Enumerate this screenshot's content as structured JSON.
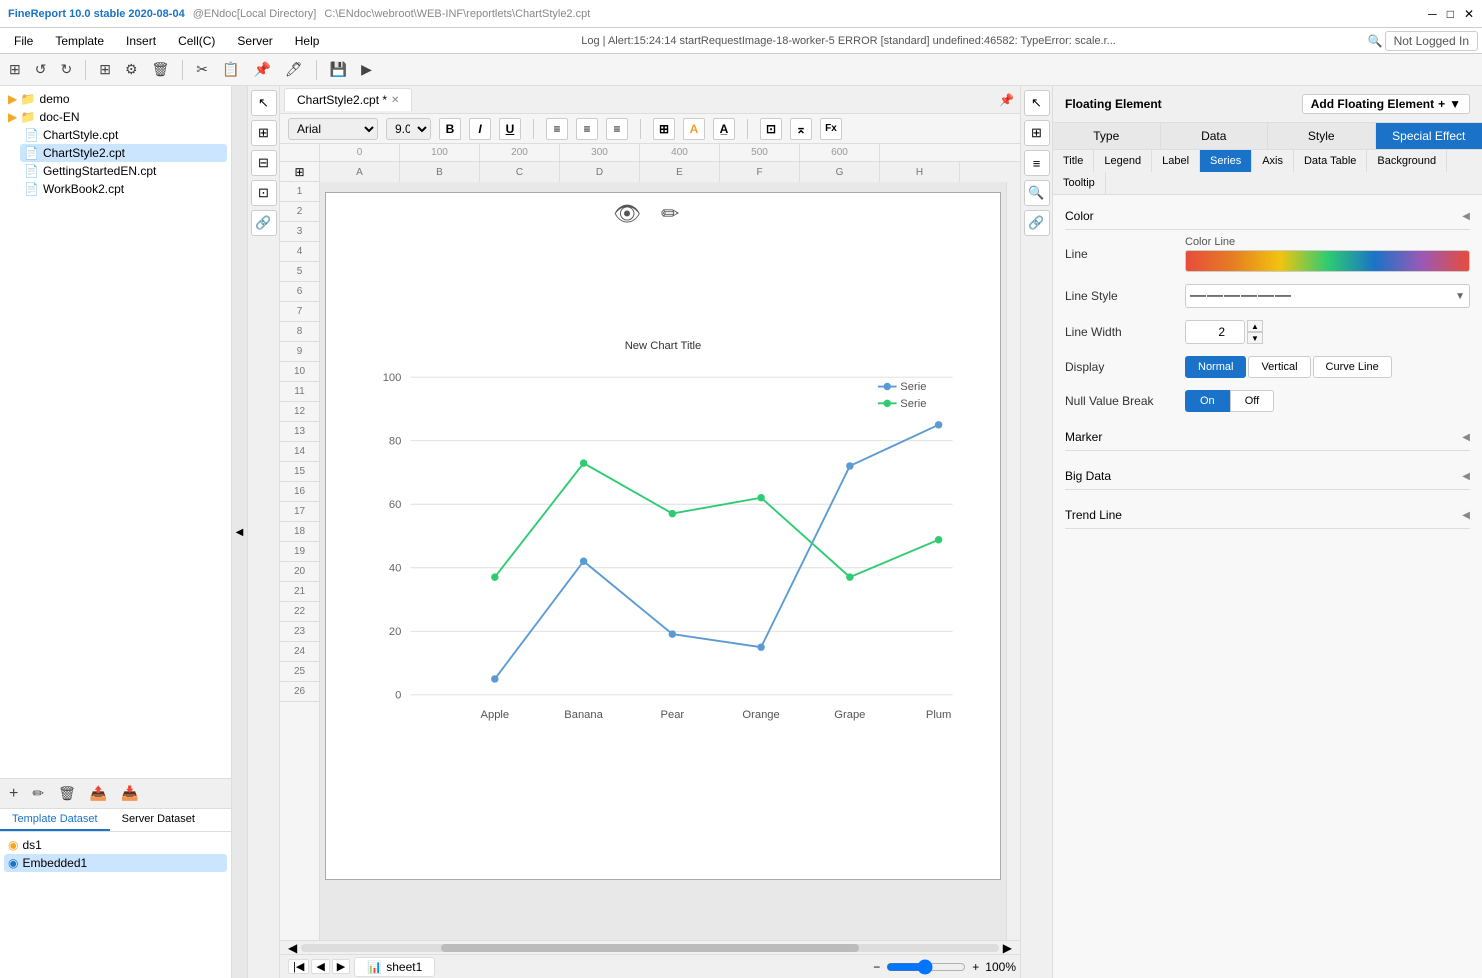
{
  "titleBar": {
    "appName": "FineReport 10.0 stable 2020-08-04",
    "env": "@ENdoc[Local Directory]",
    "filePath": "C:\\ENdoc\\webroot\\WEB-INF\\reportlets\\ChartStyle2.cpt",
    "controls": [
      "─",
      "□",
      "✕"
    ]
  },
  "menuBar": {
    "items": [
      "File",
      "Template",
      "Insert",
      "Cell(C)",
      "Server",
      "Help"
    ],
    "alert": "Log | Alert:15:24:14 startRequestImage-18-worker-5 ERROR [standard] undefined:46582: TypeError: scale.r...",
    "searchIcon": "🔍",
    "loginStatus": "Not Logged In"
  },
  "toolbar": {
    "buttons": [
      "🏠",
      "↺",
      "↻",
      "⊞",
      "⚙",
      "🗑",
      "📋",
      "📂",
      "💾",
      "🖊"
    ]
  },
  "formulaBar": {
    "font": "Arial",
    "fontSize": "9.0",
    "boldLabel": "B",
    "italicLabel": "I",
    "underlineLabel": "U"
  },
  "docTabs": [
    {
      "name": "ChartStyle2.cpt",
      "modified": true,
      "active": true
    }
  ],
  "fileTree": {
    "items": [
      {
        "id": "demo",
        "label": "demo",
        "type": "folder",
        "level": 0
      },
      {
        "id": "doc-EN",
        "label": "doc-EN",
        "type": "folder",
        "level": 0
      },
      {
        "id": "ChartStyle",
        "label": "ChartStyle.cpt",
        "type": "file",
        "level": 1
      },
      {
        "id": "ChartStyle2",
        "label": "ChartStyle2.cpt",
        "type": "file",
        "level": 1,
        "active": true
      },
      {
        "id": "GettingStartedEN",
        "label": "GettingStartedEN.cpt",
        "type": "file",
        "level": 1
      },
      {
        "id": "WorkBook2",
        "label": "WorkBook2.cpt",
        "type": "file",
        "level": 1
      }
    ]
  },
  "datasetPanel": {
    "tabs": [
      {
        "label": "Template Dataset",
        "active": true
      },
      {
        "label": "Server Dataset",
        "active": false
      }
    ],
    "items": [
      {
        "id": "ds1",
        "label": "ds1",
        "type": "dataset"
      },
      {
        "id": "Embedded1",
        "label": "Embedded1",
        "type": "embedded",
        "active": true
      }
    ]
  },
  "chart": {
    "title": "New Chart Title",
    "xLabels": [
      "Apple",
      "Banana",
      "Pear",
      "Orange",
      "Grape",
      "Plum"
    ],
    "series": [
      {
        "name": "Serie",
        "color": "#5b9bd5",
        "data": [
          5,
          42,
          19,
          15,
          72,
          85
        ]
      },
      {
        "name": "Serie",
        "color": "#2ecc71",
        "data": [
          37,
          73,
          57,
          62,
          37,
          49
        ]
      }
    ],
    "yAxis": {
      "min": 0,
      "max": 100,
      "ticks": [
        0,
        20,
        40,
        60,
        80,
        100
      ]
    }
  },
  "sheetTabs": [
    {
      "label": "sheet1",
      "active": true
    }
  ],
  "rightPanel": {
    "title": "Floating Element",
    "addButtonLabel": "Add Floating Element",
    "addIcon": "+",
    "tabs": [
      {
        "label": "Type",
        "active": false
      },
      {
        "label": "Data",
        "active": false
      },
      {
        "label": "Style",
        "active": false
      },
      {
        "label": "Special Effect",
        "active": false
      }
    ],
    "subTabs": [
      {
        "label": "Title",
        "active": false
      },
      {
        "label": "Legend",
        "active": false
      },
      {
        "label": "Label",
        "active": false
      },
      {
        "label": "Series",
        "active": true
      },
      {
        "label": "Axis",
        "active": false
      },
      {
        "label": "Data Table",
        "active": false
      },
      {
        "label": "Background",
        "active": false
      },
      {
        "label": "Tooltip",
        "active": false
      }
    ],
    "sections": {
      "color": {
        "title": "Color",
        "lineLabel": "Line",
        "colorLineTitle": "Color Line"
      },
      "lineStyle": {
        "title": "Line Style",
        "dropdownValue": "——————",
        "dropdownArrow": "▼"
      },
      "lineWidth": {
        "title": "Line Width",
        "value": "2",
        "spinUp": "▲",
        "spinDown": "▼"
      },
      "display": {
        "title": "Display",
        "options": [
          "Normal",
          "Vertical",
          "Curve Line"
        ],
        "activeOption": "Normal"
      },
      "nullValueBreak": {
        "title": "Null Value Break",
        "options": [
          "On",
          "Off"
        ],
        "activeOption": "On"
      },
      "marker": {
        "title": "Marker",
        "chevron": "◀"
      },
      "bigData": {
        "title": "Big Data",
        "chevron": "◀"
      },
      "trendLine": {
        "title": "Trend Line",
        "chevron": "◀"
      }
    }
  },
  "rowNumbers": [
    1,
    2,
    3,
    4,
    5,
    6,
    7,
    8,
    9,
    10,
    11,
    12,
    13,
    14,
    15,
    16,
    17,
    18,
    19,
    20,
    21,
    22,
    23,
    24,
    25,
    26
  ],
  "colLetters": [
    "A",
    "B",
    "C",
    "D",
    "E",
    "F",
    "G",
    "H"
  ],
  "zoomLevel": "100%"
}
